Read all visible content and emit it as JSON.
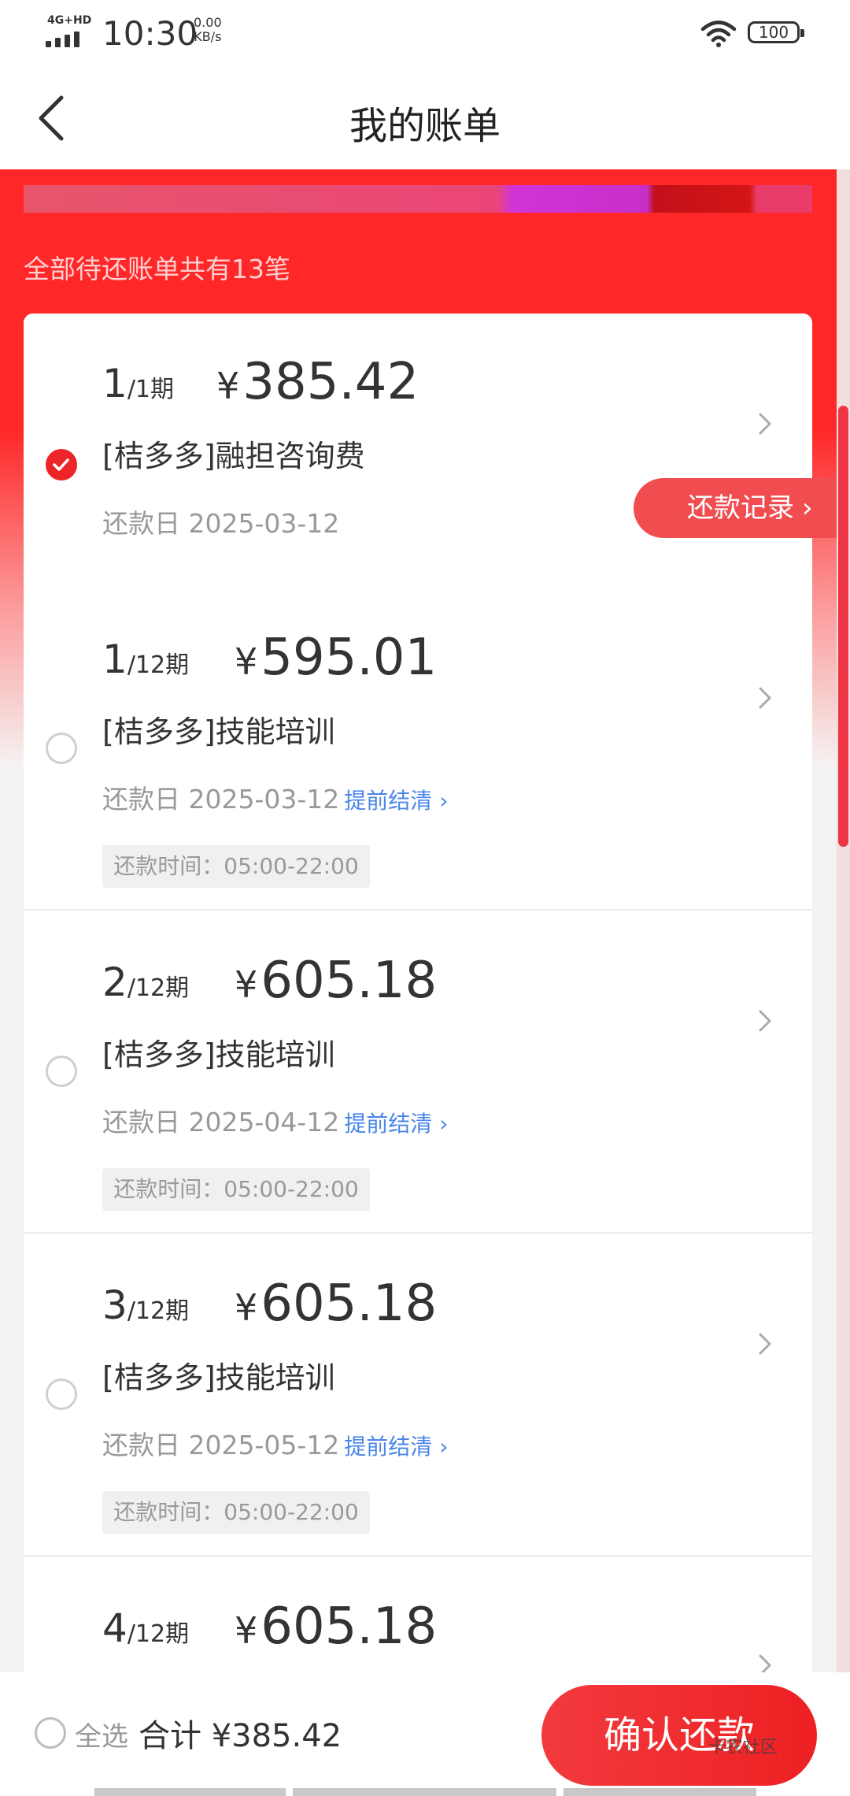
{
  "status_bar": {
    "network": "4G+HD",
    "time": "10:30",
    "speed_value": "0.00",
    "speed_unit": "KB/s",
    "battery": "100"
  },
  "nav": {
    "title": "我的账单"
  },
  "summary": "全部待还账单共有13笔",
  "record_button": "还款记录",
  "bills": [
    {
      "period": "1",
      "period_total": "/1期",
      "amount": "385.42",
      "name": "[桔多多]融担咨询费",
      "due_label": "还款日",
      "due_date": "2025-03-12",
      "checked": true
    },
    {
      "period": "1",
      "period_total": "/12期",
      "amount": "595.01",
      "name": "[桔多多]技能培训",
      "due_label": "还款日",
      "due_date": "2025-03-12",
      "early_link": "提前结清",
      "time_window": "还款时间：05:00-22:00",
      "checked": false
    },
    {
      "period": "2",
      "period_total": "/12期",
      "amount": "605.18",
      "name": "[桔多多]技能培训",
      "due_label": "还款日",
      "due_date": "2025-04-12",
      "early_link": "提前结清",
      "time_window": "还款时间：05:00-22:00",
      "checked": false
    },
    {
      "period": "3",
      "period_total": "/12期",
      "amount": "605.18",
      "name": "[桔多多]技能培训",
      "due_label": "还款日",
      "due_date": "2025-05-12",
      "early_link": "提前结清",
      "time_window": "还款时间：05:00-22:00",
      "checked": false
    },
    {
      "period": "4",
      "period_total": "/12期",
      "amount": "605.18",
      "checked": false
    }
  ],
  "currency_symbol": "¥",
  "bottom_bar": {
    "select_all_label": "全选",
    "total_text": "合计 ¥385.42",
    "confirm_label": "确认还款",
    "watermark": "卡农社区"
  },
  "colors": {
    "brand_red": "#ff2727",
    "button_red": "#ee2528",
    "link_blue": "#4a86e8"
  }
}
